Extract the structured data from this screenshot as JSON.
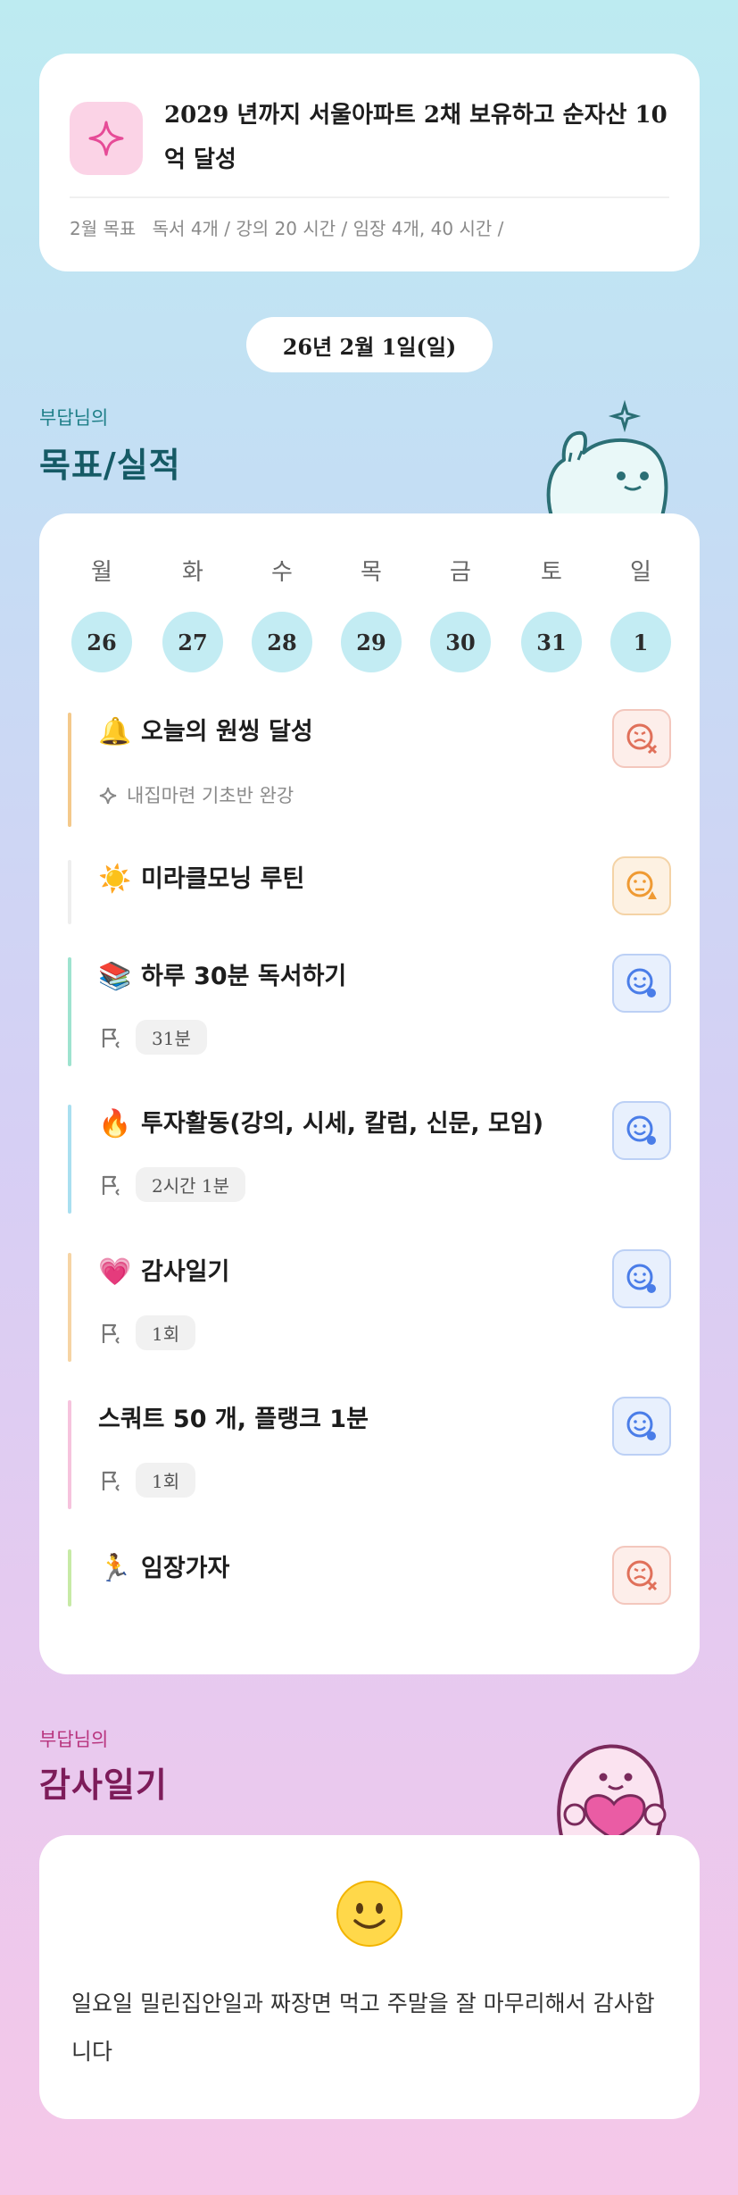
{
  "goal": {
    "title": "2029 년까지 서울아파트 2채 보유하고 순자산 10억 달성",
    "month_label": "2월 목표",
    "items": [
      "독서 4개 /",
      "강의 20 시간 /",
      "임장 4개, 40 시간 /"
    ]
  },
  "date": "26년 2월 1일(일)",
  "goals_section": {
    "sub": "부답님의",
    "title": "목표/실적"
  },
  "calendar": {
    "weekdays": [
      "월",
      "화",
      "수",
      "목",
      "금",
      "토",
      "일"
    ],
    "days": [
      "26",
      "27",
      "28",
      "29",
      "30",
      "31",
      "1"
    ],
    "selected_day": "1"
  },
  "habits": [
    {
      "title": "오늘의 원씽 달성",
      "emoji": "bell",
      "color": "#f4c98b",
      "sub": "내집마련 기초반 완강",
      "status": "fail"
    },
    {
      "title": "미라클모닝 루틴",
      "emoji": "sun",
      "color": "#eeeeee",
      "status": "partial"
    },
    {
      "title": "하루 30분 독서하기",
      "emoji": "books",
      "color": "#9ee3cf",
      "record": "31분",
      "status": "done"
    },
    {
      "title": "투자활동(강의, 시세, 칼럼, 신문, 모임)",
      "emoji": "fire",
      "color": "#a9dff0",
      "record": "2시간 1분",
      "status": "done"
    },
    {
      "title": "감사일기",
      "emoji": "heart",
      "color": "#f6d4a4",
      "record": "1회",
      "status": "done"
    },
    {
      "title": "스쿼트 50 개, 플랭크 1분",
      "emoji": "",
      "color": "#f6c3dd",
      "record": "1회",
      "status": "done"
    },
    {
      "title": "임장가자",
      "emoji": "runner",
      "color": "#c7eaa6",
      "status": "fail"
    }
  ],
  "gratitude_section": {
    "sub": "부답님의",
    "title": "감사일기"
  },
  "gratitude": {
    "mood": "smile-emoji",
    "text": "일요일 밀린집안일과 짜장면 먹고 주말을 잘 마무리해서 감사합니다"
  },
  "colors": {
    "accent": "#155a65",
    "circle": "#c3ecf3",
    "fail": "#e0705a",
    "partial": "#ef9a33",
    "done": "#4a7de8"
  }
}
